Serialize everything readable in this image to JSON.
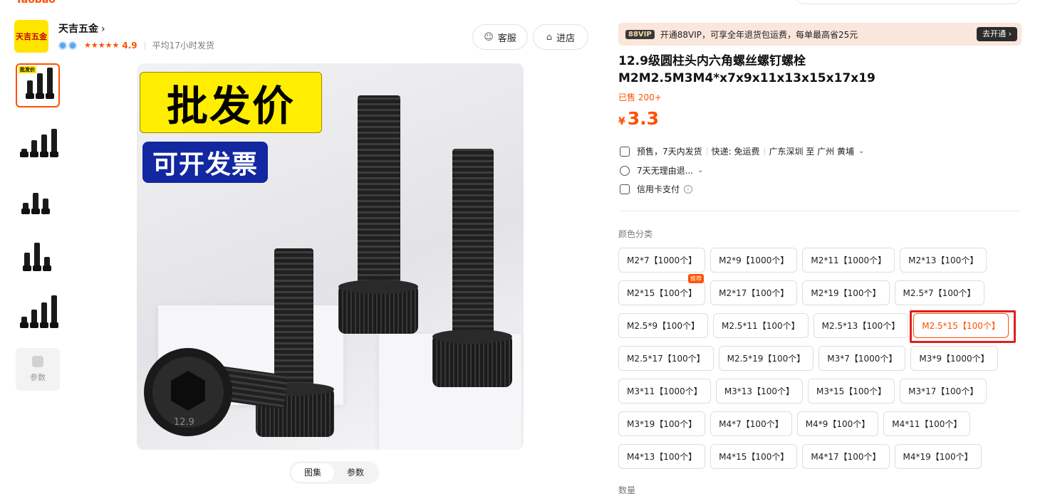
{
  "top": {
    "logo_text": "Taobao"
  },
  "shop": {
    "logo_text": "天吉五金",
    "name": "天吉五金",
    "rating": "4.9",
    "stars": "★★★★★",
    "ship_time": "平均17小时发货",
    "service_label": "客服",
    "enter_label": "进店"
  },
  "gallery": {
    "thumb_label": "批发价",
    "params_label": "参数",
    "banner_wholesale": "批发价",
    "banner_invoice": "可开发票",
    "head_marking": "12.9",
    "tabs": [
      {
        "label": "图集"
      },
      {
        "label": "参数"
      }
    ]
  },
  "vip": {
    "badge": "88VIP",
    "text": "开通88VIP，可享全年退货包运费，每单最高省25元",
    "button": "去开通 ›"
  },
  "product": {
    "title": "12.9级圆柱头内六角螺丝螺钉螺栓M2M2.5M3M4*x7x9x11x13x15x17x19",
    "sold": "已售 200+",
    "currency": "¥",
    "price": "3.3"
  },
  "delivery": {
    "presale": "预售，7天内发货",
    "shipping": "快递: 免运费",
    "route": "广东深圳 至 广州 黄埔",
    "returns": "7天无理由退...",
    "payment": "信用卡支付"
  },
  "sections": {
    "color_label": "颜色分类",
    "qty_label": "数量"
  },
  "skus": [
    [
      {
        "label": "M2*7【1000个】"
      },
      {
        "label": "M2*9【1000个】"
      },
      {
        "label": "M2*11【1000个】"
      },
      {
        "label": "M2*13【100个】"
      }
    ],
    [
      {
        "label": "M2*15【100个】",
        "badge": "推荐"
      },
      {
        "label": "M2*17【100个】"
      },
      {
        "label": "M2*19【100个】"
      },
      {
        "label": "M2.5*7【100个】"
      }
    ],
    [
      {
        "label": "M2.5*9【100个】"
      },
      {
        "label": "M2.5*11【100个】"
      },
      {
        "label": "M2.5*13【100个】"
      },
      {
        "label": "M2.5*15【100个】",
        "selected": true
      }
    ],
    [
      {
        "label": "M2.5*17【100个】"
      },
      {
        "label": "M2.5*19【100个】"
      },
      {
        "label": "M3*7【1000个】"
      },
      {
        "label": "M3*9【1000个】"
      }
    ],
    [
      {
        "label": "M3*11【1000个】"
      },
      {
        "label": "M3*13【100个】"
      },
      {
        "label": "M3*15【100个】"
      },
      {
        "label": "M3*17【100个】"
      }
    ],
    [
      {
        "label": "M3*19【100个】"
      },
      {
        "label": "M4*7【100个】"
      },
      {
        "label": "M4*9【100个】"
      },
      {
        "label": "M4*11【100个】"
      }
    ],
    [
      {
        "label": "M4*13【100个】"
      },
      {
        "label": "M4*15【100个】"
      },
      {
        "label": "M4*17【100个】"
      },
      {
        "label": "M4*19【100个】"
      }
    ]
  ],
  "colors": {
    "accent": "#ff5000",
    "highlight": "#e02020",
    "vip_bg": "#fbe6dc"
  }
}
